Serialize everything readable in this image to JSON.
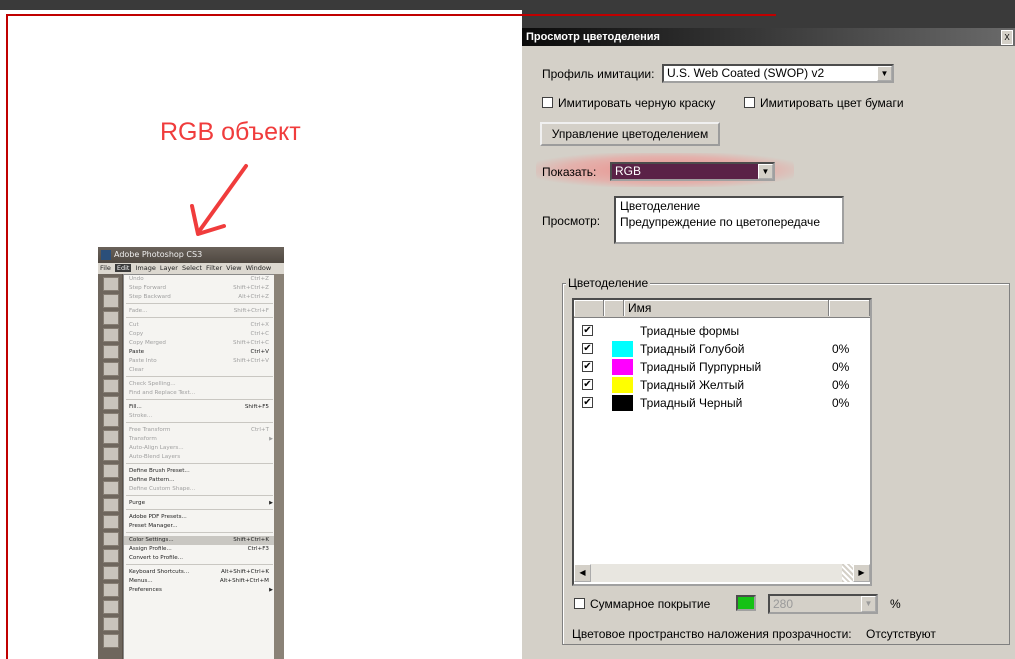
{
  "annotation": {
    "text": "RGB объект"
  },
  "photoshop": {
    "title": "Adobe Photoshop CS3",
    "menubar": [
      "File",
      "Edit",
      "Image",
      "Layer",
      "Select",
      "Filter",
      "View",
      "Window"
    ],
    "edit_menu": [
      {
        "label": "Undo",
        "shortcut": "Ctrl+Z",
        "state": "disabled"
      },
      {
        "label": "Step Forward",
        "shortcut": "Shift+Ctrl+Z",
        "state": "disabled"
      },
      {
        "label": "Step Backward",
        "shortcut": "Alt+Ctrl+Z",
        "state": "disabled"
      },
      {
        "sep": true
      },
      {
        "label": "Fade...",
        "shortcut": "Shift+Ctrl+F",
        "state": "disabled"
      },
      {
        "sep": true
      },
      {
        "label": "Cut",
        "shortcut": "Ctrl+X",
        "state": "disabled"
      },
      {
        "label": "Copy",
        "shortcut": "Ctrl+C",
        "state": "disabled"
      },
      {
        "label": "Copy Merged",
        "shortcut": "Shift+Ctrl+C",
        "state": "disabled"
      },
      {
        "label": "Paste",
        "shortcut": "Ctrl+V",
        "state": "enabled"
      },
      {
        "label": "Paste Into",
        "shortcut": "Shift+Ctrl+V",
        "state": "disabled"
      },
      {
        "label": "Clear",
        "shortcut": "",
        "state": "disabled"
      },
      {
        "sep": true
      },
      {
        "label": "Check Spelling...",
        "shortcut": "",
        "state": "disabled"
      },
      {
        "label": "Find and Replace Text...",
        "shortcut": "",
        "state": "disabled"
      },
      {
        "sep": true
      },
      {
        "label": "Fill...",
        "shortcut": "Shift+F5",
        "state": "enabled"
      },
      {
        "label": "Stroke...",
        "shortcut": "",
        "state": "disabled"
      },
      {
        "sep": true
      },
      {
        "label": "Free Transform",
        "shortcut": "Ctrl+T",
        "state": "disabled"
      },
      {
        "label": "Transform",
        "shortcut": "",
        "state": "disabled",
        "sub": true
      },
      {
        "label": "Auto-Align Layers...",
        "shortcut": "",
        "state": "disabled"
      },
      {
        "label": "Auto-Blend Layers",
        "shortcut": "",
        "state": "disabled"
      },
      {
        "sep": true
      },
      {
        "label": "Define Brush Preset...",
        "shortcut": "",
        "state": "enabled"
      },
      {
        "label": "Define Pattern...",
        "shortcut": "",
        "state": "enabled"
      },
      {
        "label": "Define Custom Shape...",
        "shortcut": "",
        "state": "disabled"
      },
      {
        "sep": true
      },
      {
        "label": "Purge",
        "shortcut": "",
        "state": "enabled",
        "sub": true
      },
      {
        "sep": true
      },
      {
        "label": "Adobe PDF Presets...",
        "shortcut": "",
        "state": "enabled"
      },
      {
        "label": "Preset Manager...",
        "shortcut": "",
        "state": "enabled"
      },
      {
        "sep": true
      },
      {
        "label": "Color Settings...",
        "shortcut": "Shift+Ctrl+K",
        "state": "hl"
      },
      {
        "label": "Assign Profile...",
        "shortcut": "Ctrl+F3",
        "state": "enabled"
      },
      {
        "label": "Convert to Profile...",
        "shortcut": "",
        "state": "enabled"
      },
      {
        "sep": true
      },
      {
        "label": "Keyboard Shortcuts...",
        "shortcut": "Alt+Shift+Ctrl+K",
        "state": "enabled"
      },
      {
        "label": "Menus...",
        "shortcut": "Alt+Shift+Ctrl+M",
        "state": "enabled"
      },
      {
        "label": "Preferences",
        "shortcut": "",
        "state": "enabled",
        "sub": true
      }
    ]
  },
  "dialog": {
    "title": "Просмотр цветоделения",
    "close_icon": "X",
    "profile_label": "Профиль имитации:",
    "profile_value": "U.S. Web Coated (SWOP) v2",
    "simulate_black_label": "Имитировать черную краску",
    "simulate_paper_label": "Имитировать цвет бумаги",
    "manage_button": "Управление цветоделением",
    "show_label": "Показать:",
    "show_value": "RGB",
    "preview_label": "Просмотр:",
    "preview_options": [
      "Цветоделение",
      "Предупреждение по цветопередаче"
    ],
    "group_title": "Цветоделение",
    "column_name": "Имя",
    "plates": [
      {
        "name": "Триадные формы",
        "checked": true,
        "color": "",
        "percent": ""
      },
      {
        "name": "Триадный Голубой",
        "checked": true,
        "color": "#00ffff",
        "percent": "0%"
      },
      {
        "name": "Триадный Пурпурный",
        "checked": true,
        "color": "#ff00ff",
        "percent": "0%"
      },
      {
        "name": "Триадный Желтый",
        "checked": true,
        "color": "#ffff00",
        "percent": "0%"
      },
      {
        "name": "Триадный Черный",
        "checked": true,
        "color": "#000000",
        "percent": "0%"
      }
    ],
    "total_coverage_label": "Суммарное покрытие",
    "total_coverage_value": "280",
    "percent_sign": "%",
    "transparency_label": "Цветовое пространство наложения прозрачности:",
    "transparency_value": "Отсутствуют"
  }
}
